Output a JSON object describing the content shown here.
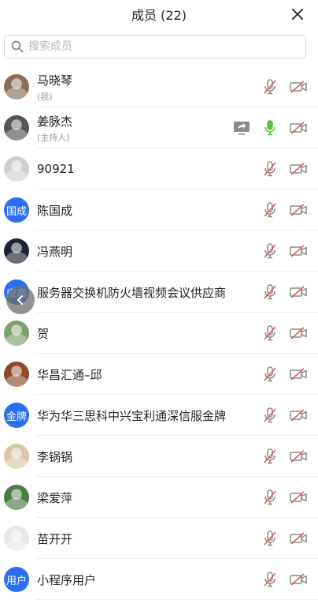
{
  "header": {
    "title": "成员 (22)"
  },
  "search": {
    "placeholder": "搜索成员"
  },
  "members": [
    {
      "name": "马晓琴",
      "role": "(我)",
      "avatar_type": "photo",
      "avatar_color": "#8a6d57",
      "mic": "muted",
      "share": false,
      "camera": "off"
    },
    {
      "name": "姜脉杰",
      "role": "(主持人)",
      "avatar_type": "photo",
      "avatar_color": "#555555",
      "mic": "active",
      "share": true,
      "camera": "off"
    },
    {
      "name": "90921",
      "role": "",
      "avatar_type": "photo",
      "avatar_color": "#cfcfcf",
      "mic": "muted",
      "share": false,
      "camera": "off"
    },
    {
      "name": "陈国成",
      "role": "",
      "avatar_type": "text",
      "avatar_text": "国成",
      "avatar_color": "#2b6ff0",
      "mic": "muted",
      "share": false,
      "camera": "off"
    },
    {
      "name": "冯燕明",
      "role": "",
      "avatar_type": "photo",
      "avatar_color": "#1f2233",
      "mic": "muted",
      "share": false,
      "camera": "off"
    },
    {
      "name": "服务器交换机防火墙视频会议供应商",
      "role": "",
      "avatar_type": "text",
      "avatar_text": "应商",
      "avatar_color": "#2b6ff0",
      "mic": "muted",
      "share": false,
      "camera": "off"
    },
    {
      "name": "贺",
      "role": "",
      "avatar_type": "photo",
      "avatar_color": "#7fa06a",
      "mic": "muted",
      "share": false,
      "camera": "off"
    },
    {
      "name": "华昌汇通–邱",
      "role": "",
      "avatar_type": "photo",
      "avatar_color": "#8b4b2b",
      "mic": "muted",
      "share": false,
      "camera": "off"
    },
    {
      "name": "华为华三思科中兴宝利通深信服金牌",
      "role": "",
      "avatar_type": "text",
      "avatar_text": "金牌",
      "avatar_color": "#2b6ff0",
      "mic": "muted",
      "share": false,
      "camera": "off"
    },
    {
      "name": "李锅锅",
      "role": "",
      "avatar_type": "photo",
      "avatar_color": "#d9c6a8",
      "mic": "muted",
      "share": false,
      "camera": "off"
    },
    {
      "name": "梁爱萍",
      "role": "",
      "avatar_type": "photo",
      "avatar_color": "#4c7a45",
      "mic": "muted",
      "share": false,
      "camera": "off"
    },
    {
      "name": "苗开开",
      "role": "",
      "avatar_type": "photo",
      "avatar_color": "#e8e8e8",
      "mic": "muted",
      "share": false,
      "camera": "off"
    },
    {
      "name": "小程序用户",
      "role": "",
      "avatar_type": "text",
      "avatar_text": "用户",
      "avatar_color": "#2b6ff0",
      "mic": "muted",
      "share": false,
      "camera": "off"
    }
  ],
  "colors": {
    "accent": "#2b6ff0",
    "mic_active": "#5bc236",
    "muted_red": "#e5534b",
    "icon_gray": "#8a8a8a"
  }
}
